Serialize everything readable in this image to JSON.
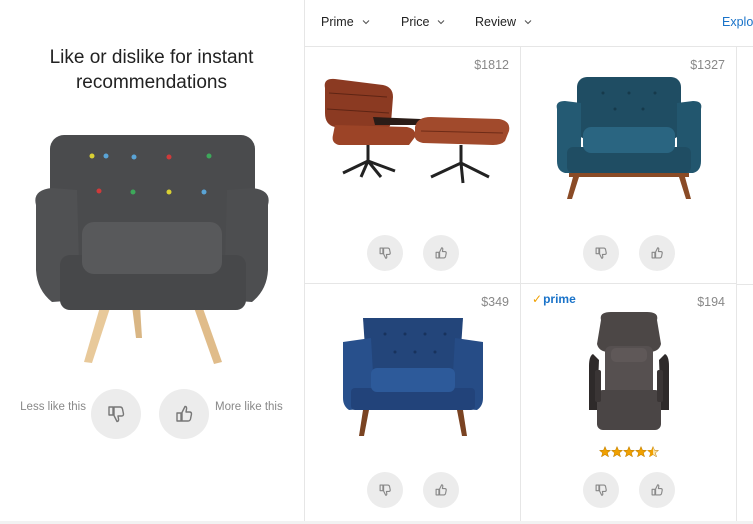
{
  "left_panel": {
    "title": "Like or dislike for instant recommendations",
    "less_label": "Less like this",
    "more_label": "More like this"
  },
  "filters": {
    "prime": "Prime",
    "price": "Price",
    "review": "Review",
    "explore": "Explo"
  },
  "products": [
    {
      "price": "$1812",
      "prime": false,
      "image": "leather-lounge-chair-with-ottoman"
    },
    {
      "price": "$1327",
      "prime": false,
      "image": "teal-armchair"
    },
    {
      "price": "$349",
      "prime": false,
      "image": "navy-armchair"
    },
    {
      "price": "$194",
      "prime": true,
      "prime_label": "prime",
      "image": "recliner-chair",
      "rating": 4.5
    }
  ],
  "colors": {
    "accent_link": "#1a73c9",
    "prime_check": "#f0a000",
    "star": "#f0a000",
    "button_bg": "#ececec"
  }
}
